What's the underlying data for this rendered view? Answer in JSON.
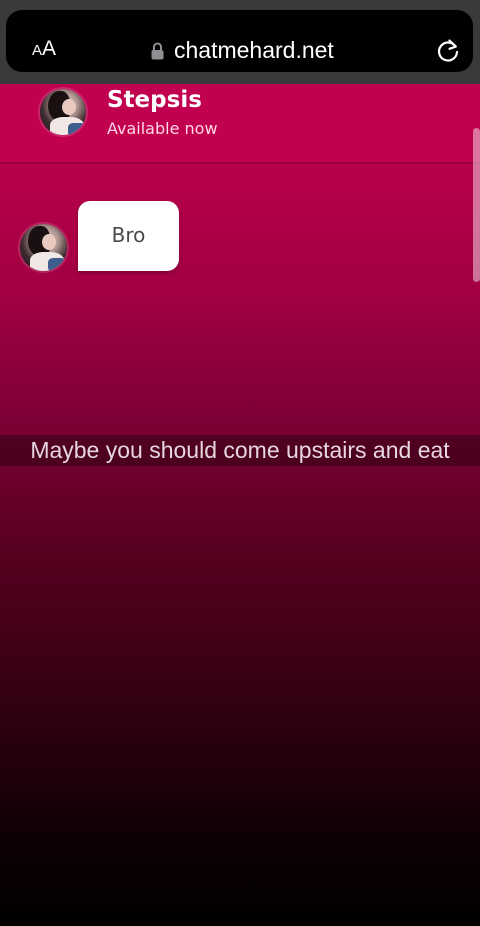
{
  "browser": {
    "text_size_small": "A",
    "text_size_big": "A",
    "url": "chatmehard.net"
  },
  "chat": {
    "contact_name": "Stepsis",
    "contact_status": "Available now",
    "messages": [
      {
        "text": "Bro"
      }
    ]
  },
  "caption": {
    "text": "Maybe you should come upstairs and eat"
  },
  "colors": {
    "header": "#c10050",
    "background_top": "#c0004e",
    "background_bottom": "#000000",
    "bubble": "#ffffff"
  },
  "icons": [
    "lock-icon",
    "reload-icon",
    "text-size-icon"
  ]
}
